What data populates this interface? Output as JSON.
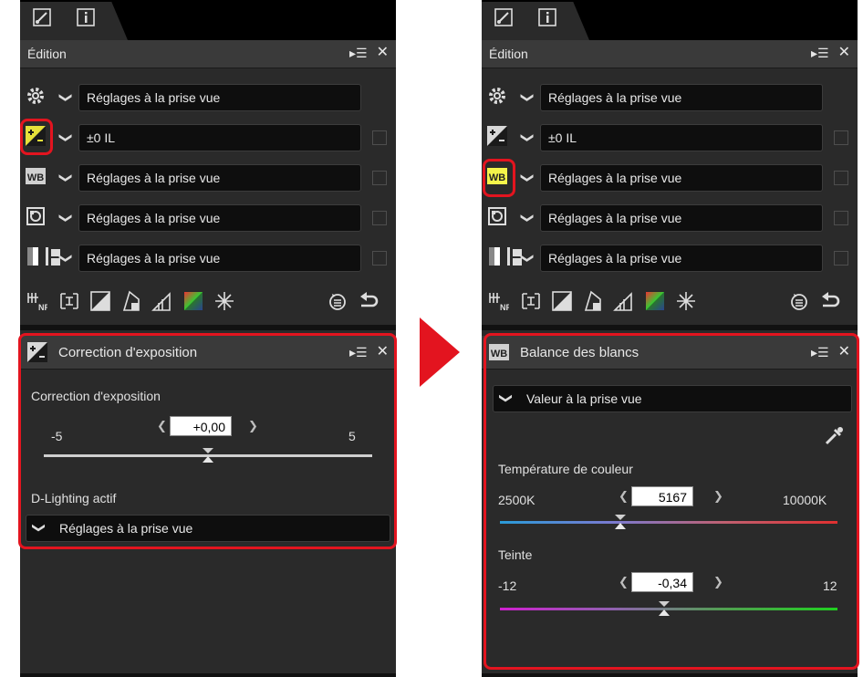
{
  "left": {
    "edit_panel": {
      "title": "Édition",
      "rows": [
        {
          "icon": "gear-icon",
          "value": "Réglages à la prise vue",
          "checkbox": false
        },
        {
          "icon": "exposure-compensation-icon",
          "value": "±0 IL",
          "checkbox": true
        },
        {
          "icon": "white-balance-icon",
          "value": "Réglages à la prise vue",
          "checkbox": true
        },
        {
          "icon": "picture-control-icon",
          "value": "Réglages à la prise vue",
          "checkbox": true
        },
        {
          "icon": "tone-icon",
          "value": "Réglages à la prise vue",
          "checkbox": true
        }
      ]
    },
    "sub_panel": {
      "title": "Correction d'exposition",
      "section_label": "Correction d'exposition",
      "slider": {
        "min_label": "-5",
        "max_label": "5",
        "value": "+0,00",
        "value_numeric": 0,
        "min": -5,
        "max": 5
      },
      "adl_label": "D-Lighting actif",
      "adl_value": "Réglages à la prise vue"
    }
  },
  "right": {
    "edit_panel": {
      "title": "Édition",
      "rows": [
        {
          "icon": "gear-icon",
          "value": "Réglages à la prise vue",
          "checkbox": false
        },
        {
          "icon": "exposure-compensation-icon",
          "value": "±0 IL",
          "checkbox": true
        },
        {
          "icon": "white-balance-icon",
          "value": "Réglages à la prise vue",
          "checkbox": true
        },
        {
          "icon": "picture-control-icon",
          "value": "Réglages à la prise vue",
          "checkbox": true
        },
        {
          "icon": "tone-icon",
          "value": "Réglages à la prise vue",
          "checkbox": true
        }
      ]
    },
    "sub_panel": {
      "title": "Balance des blancs",
      "wb_mode": "Valeur à la prise vue",
      "temp_label": "Température de couleur",
      "temp": {
        "min_label": "2500K",
        "max_label": "10000K",
        "value": "5167",
        "value_numeric": 5167,
        "min": 2500,
        "max": 10000
      },
      "tint_label": "Teinte",
      "tint": {
        "min_label": "-12",
        "max_label": "12",
        "value": "-0,34",
        "value_numeric": -0.34,
        "min": -12,
        "max": 12
      }
    }
  },
  "colors": {
    "highlight": "#e3141f",
    "panel_bg": "#2a2a2a",
    "wb_active": "#f4f44a",
    "exp_active": "#e6e13a"
  }
}
